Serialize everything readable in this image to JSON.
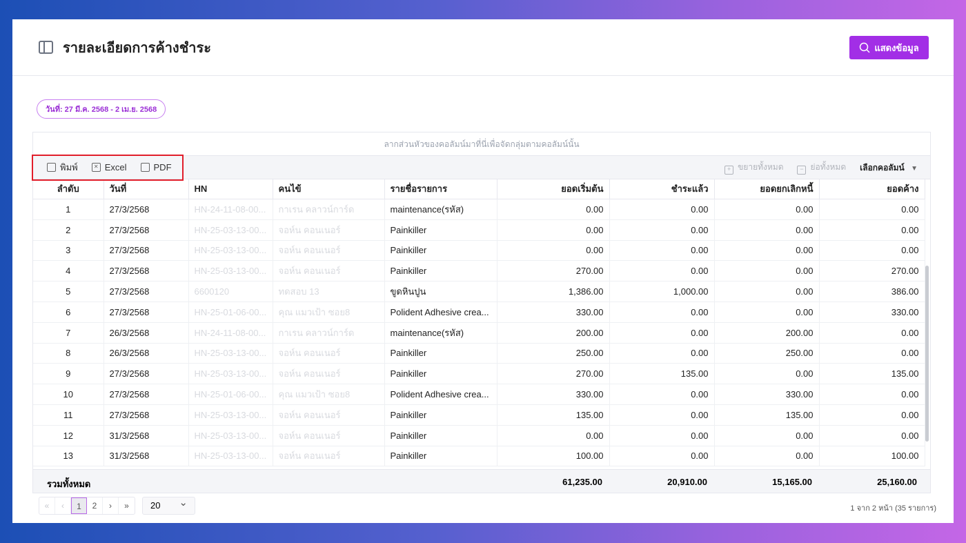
{
  "header": {
    "title": "รายละเอียดการค้างชำระ",
    "show_button": "แสดงข้อมูล"
  },
  "date_filter": "วันที่: 27 มี.ค. 2568 - 2 เม.ย. 2568",
  "grid": {
    "group_hint": "ลากส่วนหัวของคอลัมน์มาที่นี่เพื่อจัดกลุ่มตามคอลัมน์นั้น",
    "toolbar": {
      "print": "พิมพ์",
      "excel": "Excel",
      "pdf": "PDF",
      "expand_all": "ขยายทั้งหมด",
      "collapse_all": "ย่อทั้งหมด",
      "choose_columns": "เลือกคอลัมน์"
    },
    "columns": [
      "ลำดับ",
      "วันที่",
      "HN",
      "คนไข้",
      "รายชื่อรายการ",
      "ยอดเริ่มต้น",
      "ชำระแล้ว",
      "ยอดยกเลิกหนี้",
      "ยอดค้าง"
    ],
    "rows": [
      [
        "1",
        "27/3/2568",
        "HN-24-11-08-00...",
        "กาเรน คลาวน์การ์ด",
        "maintenance(รหัส)",
        "0.00",
        "0.00",
        "0.00",
        "0.00"
      ],
      [
        "2",
        "27/3/2568",
        "HN-25-03-13-00...",
        "จอห์น คอนเนอร์",
        "Painkiller",
        "0.00",
        "0.00",
        "0.00",
        "0.00"
      ],
      [
        "3",
        "27/3/2568",
        "HN-25-03-13-00...",
        "จอห์น คอนเนอร์",
        "Painkiller",
        "0.00",
        "0.00",
        "0.00",
        "0.00"
      ],
      [
        "4",
        "27/3/2568",
        "HN-25-03-13-00...",
        "จอห์น คอนเนอร์",
        "Painkiller",
        "270.00",
        "0.00",
        "0.00",
        "270.00"
      ],
      [
        "5",
        "27/3/2568",
        "6600120",
        "ทดสอบ 13",
        "ขูดหินปูน",
        "1,386.00",
        "1,000.00",
        "0.00",
        "386.00"
      ],
      [
        "6",
        "27/3/2568",
        "HN-25-01-06-00...",
        "คุณ แมวเป้า ซอย8",
        "Polident Adhesive crea...",
        "330.00",
        "0.00",
        "0.00",
        "330.00"
      ],
      [
        "7",
        "26/3/2568",
        "HN-24-11-08-00...",
        "กาเรน คลาวน์การ์ด",
        "maintenance(รหัส)",
        "200.00",
        "0.00",
        "200.00",
        "0.00"
      ],
      [
        "8",
        "26/3/2568",
        "HN-25-03-13-00...",
        "จอห์น คอนเนอร์",
        "Painkiller",
        "250.00",
        "0.00",
        "250.00",
        "0.00"
      ],
      [
        "9",
        "27/3/2568",
        "HN-25-03-13-00...",
        "จอห์น คอนเนอร์",
        "Painkiller",
        "270.00",
        "135.00",
        "0.00",
        "135.00"
      ],
      [
        "10",
        "27/3/2568",
        "HN-25-01-06-00...",
        "คุณ แมวเป้า ซอย8",
        "Polident Adhesive crea...",
        "330.00",
        "0.00",
        "330.00",
        "0.00"
      ],
      [
        "11",
        "27/3/2568",
        "HN-25-03-13-00...",
        "จอห์น คอนเนอร์",
        "Painkiller",
        "135.00",
        "0.00",
        "135.00",
        "0.00"
      ],
      [
        "12",
        "31/3/2568",
        "HN-25-03-13-00...",
        "จอห์น คอนเนอร์",
        "Painkiller",
        "0.00",
        "0.00",
        "0.00",
        "0.00"
      ],
      [
        "13",
        "31/3/2568",
        "HN-25-03-13-00...",
        "จอห์น คอนเนอร์",
        "Painkiller",
        "100.00",
        "0.00",
        "0.00",
        "100.00"
      ]
    ],
    "totals": {
      "label": "รวมทั้งหมด",
      "start": "61,235.00",
      "paid": "20,910.00",
      "written_off": "15,165.00",
      "outstanding": "25,160.00"
    }
  },
  "pagination": {
    "first": "«",
    "prev": "‹",
    "pages": [
      "1",
      "2"
    ],
    "next": "›",
    "last": "»",
    "page_size": "20",
    "info": "1 จาก 2 หน้า (35 รายการ)"
  }
}
